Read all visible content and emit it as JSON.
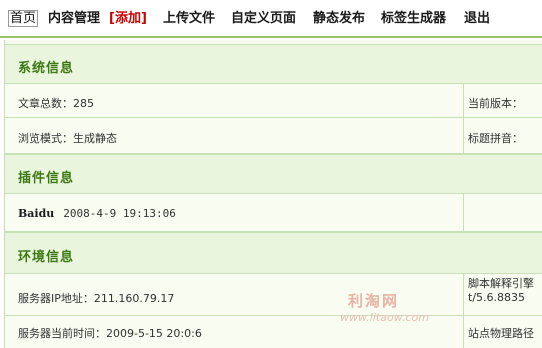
{
  "nav": {
    "items": [
      {
        "label": "首页"
      },
      {
        "label": "内容管理"
      },
      {
        "label": "[添加]"
      },
      {
        "label": "上传文件"
      },
      {
        "label": "自定义页面"
      },
      {
        "label": "静态发布"
      },
      {
        "label": "标签生成器"
      },
      {
        "label": "退出"
      }
    ]
  },
  "system": {
    "title": "系统信息",
    "article_count": "文章总数：285",
    "current_version": "当前版本：",
    "browse_mode": "浏览模式：生成静态",
    "title_pinyin": "标题拼音："
  },
  "plugins": {
    "title": "插件信息",
    "name": "Baidu",
    "date": "2008-4-9 19:13:06"
  },
  "env": {
    "title": "环境信息",
    "server_ip": "服务器IP地址：211.160.79.17",
    "script_engine_line1": "脚本解释引擎",
    "script_engine_line2": "t/5.6.8835",
    "server_time": "服务器当前时间：2009-5-15 20:0:6",
    "site_path": "站点物理路径"
  },
  "watermark": {
    "title": "利淘网",
    "url": "www.litaow.com"
  }
}
